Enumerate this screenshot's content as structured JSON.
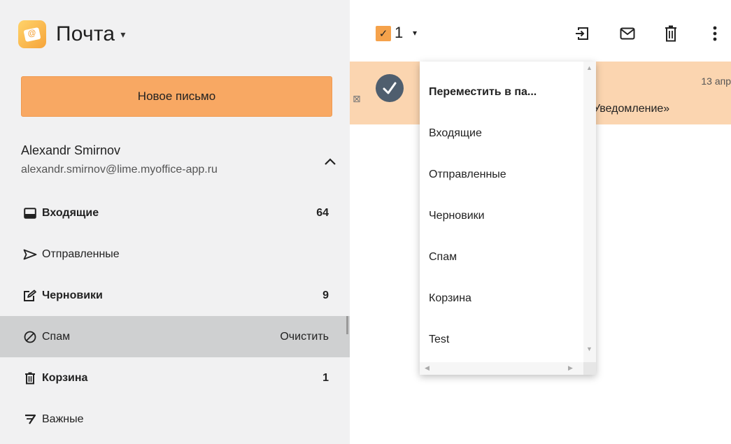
{
  "app": {
    "title": "Почта",
    "caret": "▾"
  },
  "compose": {
    "label": "Новое письмо"
  },
  "account": {
    "name": "Alexandr Smirnov",
    "email": "alexandr.smirnov@lime.myoffice-app.ru"
  },
  "folders": [
    {
      "label": "Входящие",
      "count": "64",
      "icon": "inbox-icon",
      "bold": true
    },
    {
      "label": "Отправленные",
      "count": "",
      "icon": "send-icon",
      "bold": false
    },
    {
      "label": "Черновики",
      "count": "9",
      "icon": "draft-icon",
      "bold": true
    },
    {
      "label": "Спам",
      "count": "Очистить",
      "icon": "spam-icon",
      "bold": false,
      "selected": true
    },
    {
      "label": "Корзина",
      "count": "1",
      "icon": "trash-icon",
      "bold": true
    },
    {
      "label": "Важные",
      "count": "",
      "icon": "important-icon",
      "bold": false
    }
  ],
  "toolbar": {
    "selected_count": "1",
    "check": "✓",
    "caret": "▾"
  },
  "message": {
    "date": "13 апр",
    "subject": "Уведомление»",
    "flag": "⊠"
  },
  "dropdown": {
    "title": "Переместить в па...",
    "items": [
      "Входящие",
      "Отправленные",
      "Черновики",
      "Спам",
      "Корзина",
      "Test"
    ]
  },
  "colors": {
    "accent": "#f8a863",
    "selected_row": "#fbd5b0",
    "sidebar_bg": "#f1f1f2",
    "folder_selected": "#cfd0d1"
  }
}
